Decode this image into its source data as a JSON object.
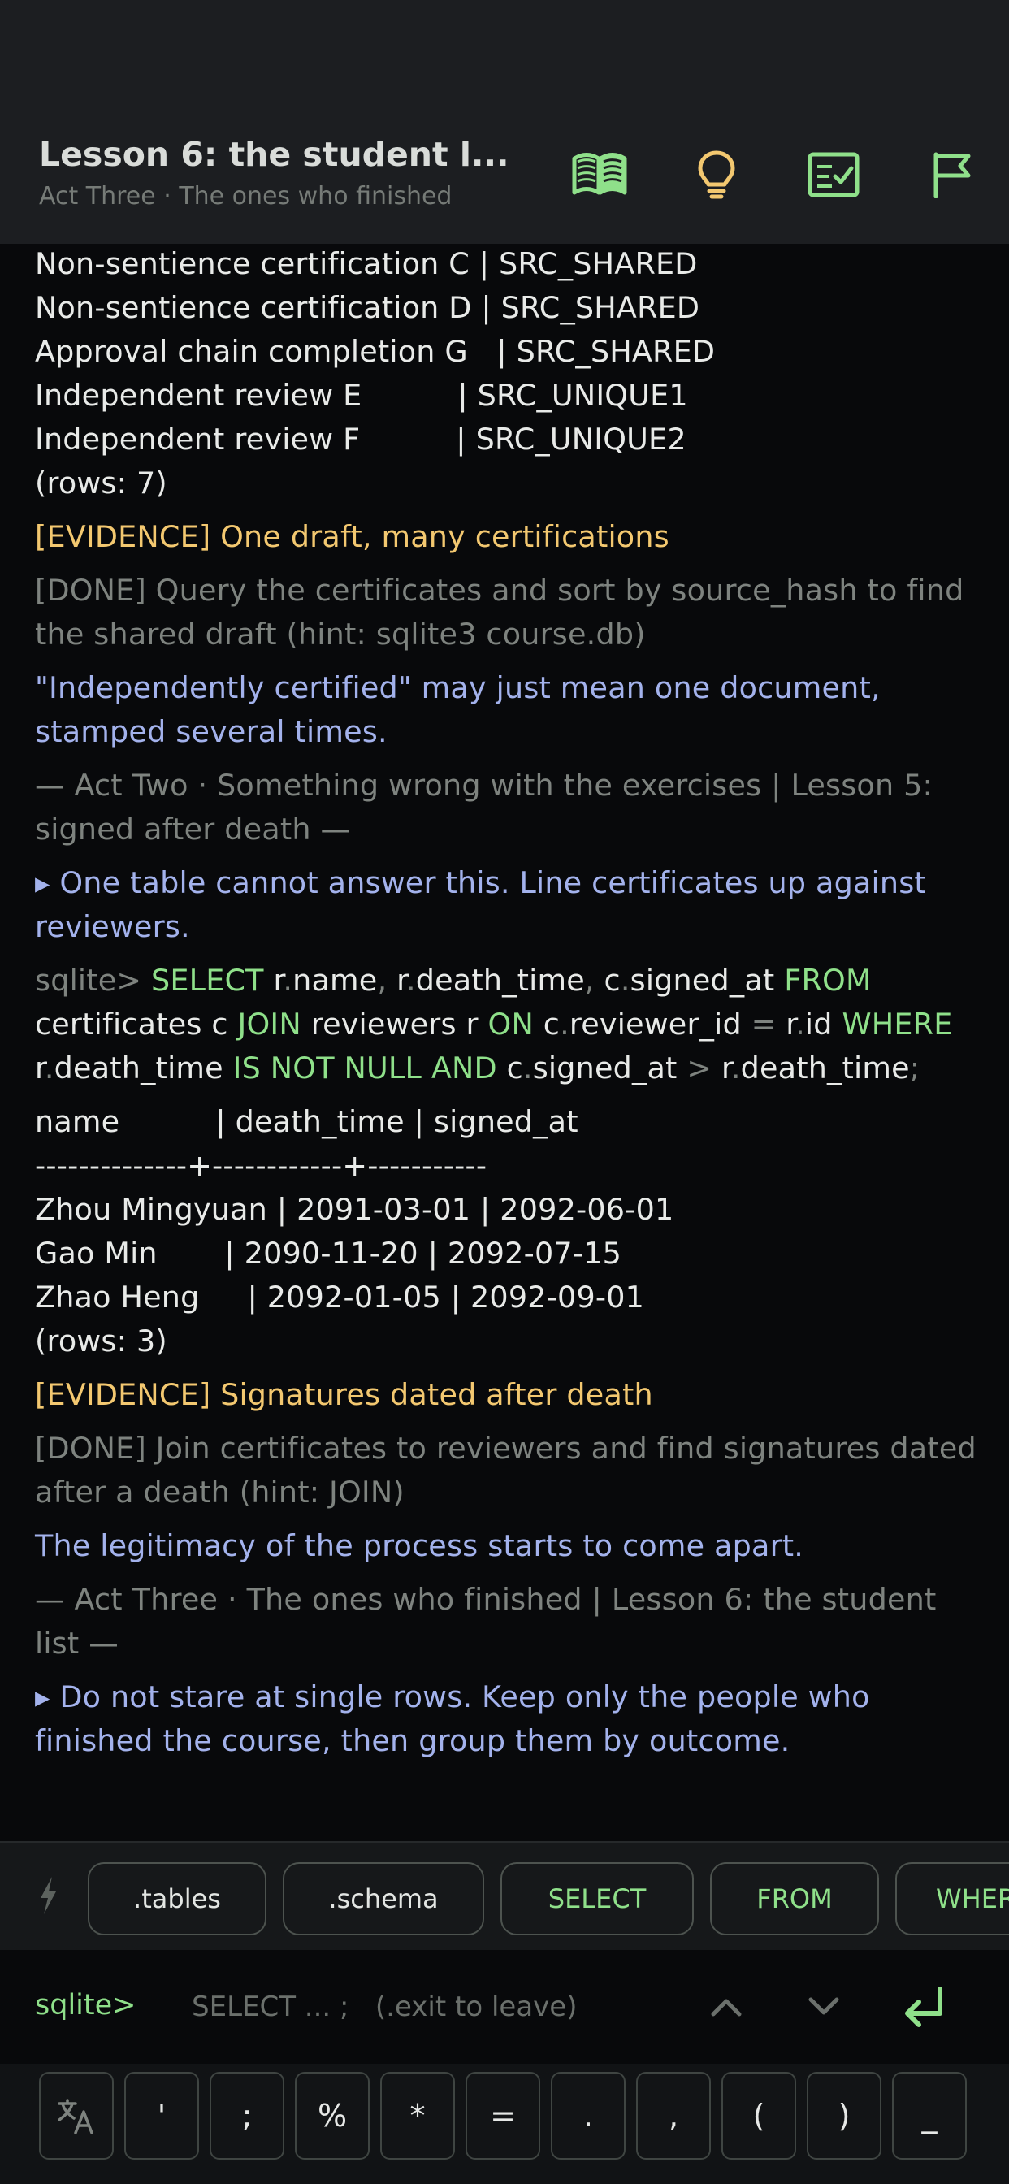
{
  "header": {
    "title": "Lesson 6: the student l...",
    "subtitle": "Act Three · The ones who finished",
    "icons": [
      "book-icon",
      "lightbulb-icon",
      "checklist-icon",
      "flag-icon"
    ],
    "accent": "#8fe08a"
  },
  "terminal": {
    "top_rows": [
      "Non-sentience certification C | SRC_SHARED",
      "Non-sentience certification D | SRC_SHARED",
      "Approval chain completion G   | SRC_SHARED",
      "Independent review E          | SRC_UNIQUE1",
      "Independent review F          | SRC_UNIQUE2",
      "(rows: 7)"
    ],
    "evidence_1": "[EVIDENCE] One draft, many certifications",
    "done_1": "[DONE] Query the certificates and sort by source_hash to find the shared draft (hint: sqlite3 course.db)",
    "narration_1": "\"Independently certified\" may just mean one document, stamped several times.",
    "separator_1": "— Act Two · Something wrong with the exercises | Lesson 5: signed after death —",
    "hint_1": "▸ One table cannot answer this. Line certificates up against reviewers.",
    "query": {
      "prompt": "sqlite>",
      "kw_select": "SELECT",
      "kw_from": "FROM",
      "kw_join": "JOIN",
      "kw_on": "ON",
      "kw_where": "WHERE",
      "kw_isnotnull": "IS NOT NULL",
      "kw_and": "AND",
      "id_r": "r",
      "id_c": "c",
      "col_name": "name",
      "col_death_time": "death_time",
      "col_signed_at": "signed_at",
      "col_reviewer_id": "reviewer_id",
      "col_id": "id",
      "tbl_certificates": "certificates",
      "tbl_reviewers": "reviewers",
      "dot": ".",
      "comma": ",",
      "eq": "=",
      "gt": ">",
      "semi": ";"
    },
    "result_header": "name          | death_time | signed_at",
    "result_divider": "--------------+------------+-----------",
    "result_rows": [
      "Zhou Mingyuan | 2091-03-01 | 2092-06-01",
      "Gao Min       | 2090-11-20 | 2092-07-15",
      "Zhao Heng     | 2092-01-05 | 2092-09-01"
    ],
    "result_count": "(rows: 3)",
    "evidence_2": "[EVIDENCE] Signatures dated after death",
    "done_2": "[DONE] Join certificates to reviewers and find signatures dated after a death (hint: JOIN)",
    "narration_2": "The legitimacy of the process starts to come apart.",
    "separator_2": "— Act Three · The ones who finished | Lesson 6: the student list —",
    "hint_2": "▸ Do not stare at single rows. Keep only the people who finished the course, then group them by outcome."
  },
  "chips": [
    ".tables",
    ".schema",
    "SELECT",
    "FROM",
    "WHERE"
  ],
  "input": {
    "prompt": "sqlite>",
    "placeholder": "SELECT ... ;   (.exit to leave)"
  },
  "keys": [
    "'",
    ";",
    "%",
    "*",
    "=",
    ".",
    ",",
    "(",
    ")",
    "_"
  ],
  "colors": {
    "keyword": "#8fe08a",
    "evidence": "#f3c870",
    "narration": "#a3b2ec",
    "muted": "#7e837f"
  }
}
